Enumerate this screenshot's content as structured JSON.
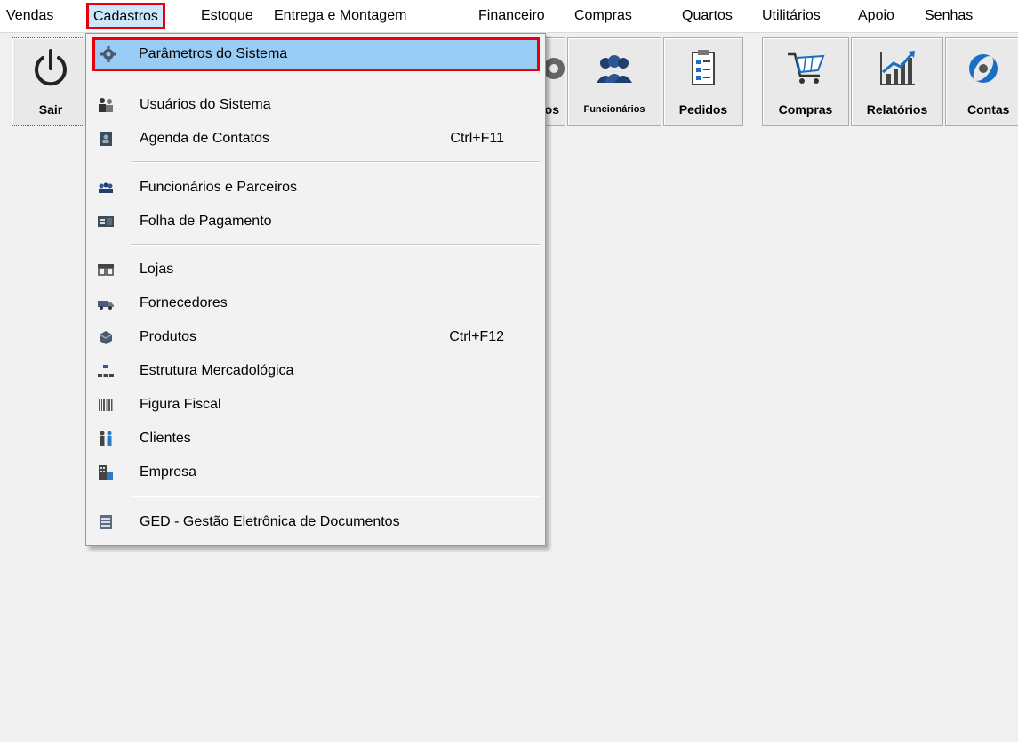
{
  "menubar": {
    "items": [
      {
        "label": "Vendas"
      },
      {
        "label": "Cadastros"
      },
      {
        "label": "Estoque"
      },
      {
        "label": "Entrega e Montagem"
      },
      {
        "label": "Financeiro"
      },
      {
        "label": "Compras"
      },
      {
        "label": "Quartos"
      },
      {
        "label": "Utilitários"
      },
      {
        "label": "Apoio"
      },
      {
        "label": "Senhas"
      }
    ]
  },
  "toolbar": {
    "buttons": [
      {
        "label": "Sair",
        "icon": "power-icon"
      },
      {
        "label": "os",
        "icon": "gear-icon"
      },
      {
        "label": "Funcionários",
        "icon": "employees-icon"
      },
      {
        "label": "Pedidos",
        "icon": "checklist-icon"
      },
      {
        "label": "Compras",
        "icon": "cart-icon"
      },
      {
        "label": "Relatórios",
        "icon": "bar-chart-icon"
      },
      {
        "label": "Contas",
        "icon": "money-icon"
      }
    ]
  },
  "dropdown": {
    "items": [
      {
        "label": "Parâmetros do Sistema",
        "shortcut": "",
        "icon": "gear-icon"
      },
      {
        "label": "Usuários do Sistema",
        "shortcut": "",
        "icon": "users-icon"
      },
      {
        "label": "Agenda de Contatos",
        "shortcut": "Ctrl+F11",
        "icon": "address-book-icon"
      },
      {
        "label": "Funcionários e Parceiros",
        "shortcut": "",
        "icon": "people-group-icon"
      },
      {
        "label": "Folha de Pagamento",
        "shortcut": "",
        "icon": "payroll-icon"
      },
      {
        "label": "Lojas",
        "shortcut": "",
        "icon": "store-icon"
      },
      {
        "label": "Fornecedores",
        "shortcut": "",
        "icon": "truck-icon"
      },
      {
        "label": "Produtos",
        "shortcut": "Ctrl+F12",
        "icon": "products-icon"
      },
      {
        "label": "Estrutura Mercadológica",
        "shortcut": "",
        "icon": "hierarchy-icon"
      },
      {
        "label": "Figura Fiscal",
        "shortcut": "",
        "icon": "barcode-icon"
      },
      {
        "label": "Clientes",
        "shortcut": "",
        "icon": "clients-icon"
      },
      {
        "label": "Empresa",
        "shortcut": "",
        "icon": "building-icon"
      },
      {
        "label": "GED - Gestão Eletrônica de Documentos",
        "shortcut": "",
        "icon": "document-icon"
      }
    ]
  },
  "colors": {
    "highlight_border": "#e8000d",
    "highlight_fill": "#99ccf5",
    "menu_active_fill": "#cce8ff",
    "accent_blue": "#1a6fc4"
  }
}
